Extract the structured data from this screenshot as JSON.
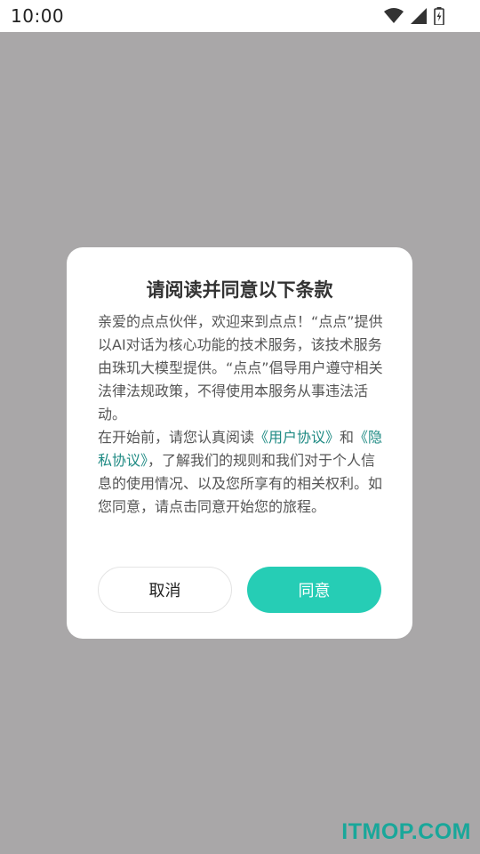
{
  "status_bar": {
    "time": "10:00",
    "icons": [
      "wifi-icon",
      "cell-signal-icon",
      "battery-charging-icon"
    ]
  },
  "dialog": {
    "title": "请阅读并同意以下条款",
    "paragraph1": "亲爱的点点伙伴，欢迎来到点点！“点点”提供以AI对话为核心功能的技术服务，该技术服务由珠玑大模型提供。“点点”倡导用户遵守相关法律法规政策，不得使用本服务从事违法活动。",
    "paragraph2_prefix": "在开始前，请您认真阅读",
    "user_agreement_link": "《用户协议》",
    "conjunction": "和",
    "privacy_policy_link": "《隐私协议》",
    "paragraph2_suffix": "，了解我们的规则和我们对于个人信息的使用情况、以及您所享有的相关权利。如您同意，请点击同意开始您的旅程。",
    "cancel_label": "取消",
    "agree_label": "同意"
  },
  "watermark": "ITMOP.COM",
  "colors": {
    "accent": "#26cdb5",
    "link": "#1e8a83",
    "scrim": "#a9a7a8",
    "watermark": "#19a79a"
  }
}
